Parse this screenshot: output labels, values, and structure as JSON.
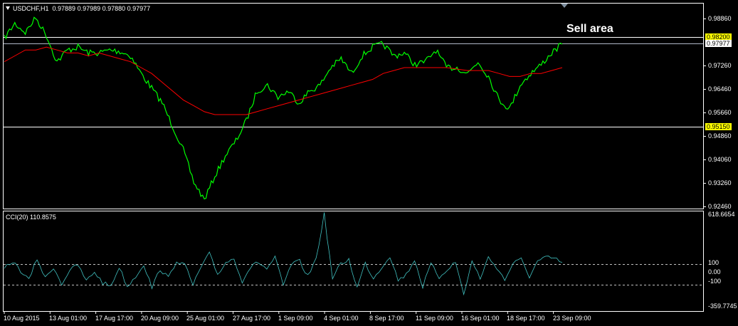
{
  "main_header": {
    "menu_icon": "triangle-down-icon",
    "symbol": "USDCHF,H1",
    "ohlc": "0.97889 0.97989 0.97880 0.97977"
  },
  "indicator_header": "CCI(20) 110.8575",
  "annotation": "Sell area",
  "levels": {
    "resistance": "0.98200",
    "current": "0.97977",
    "support": "0.95150"
  },
  "colors": {
    "background": "#000000",
    "price_line": "#00ff00",
    "moving_average": "#ff0000",
    "cci_line": "#40c0c0",
    "level_tag": "#ffff00",
    "current_tag": "#ffffff"
  },
  "chart_data": [
    {
      "type": "line",
      "symbol": "USDCHF",
      "timeframe": "H1",
      "title": "USDCHF,H1",
      "ylim": [
        0.9246,
        0.9886
      ],
      "y_ticks": [
        "0.98860",
        "0.97977",
        "0.97260",
        "0.96460",
        "0.95660",
        "0.94860",
        "0.94060",
        "0.93260",
        "0.92460"
      ],
      "x_ticks": [
        "10 Aug 2015",
        "13 Aug 01:00",
        "17 Aug 17:00",
        "20 Aug 09:00",
        "25 Aug 01:00",
        "27 Aug 17:00",
        "1 Sep 09:00",
        "4 Sep 01:00",
        "8 Sep 17:00",
        "11 Sep 09:00",
        "16 Sep 01:00",
        "18 Sep 17:00",
        "23 Sep 09:00"
      ],
      "series": [
        {
          "values": [
            0.982,
            0.987,
            0.984,
            0.989,
            0.983,
            0.974,
            0.978,
            0.979,
            0.977,
            0.977,
            0.978,
            0.9775,
            0.976,
            0.97,
            0.965,
            0.96,
            0.952,
            0.944,
            0.933,
            0.927,
            0.935,
            0.942,
            0.947,
            0.954,
            0.964,
            0.966,
            0.962,
            0.964,
            0.96,
            0.964,
            0.966,
            0.972,
            0.975,
            0.97,
            0.976,
            0.979,
            0.98,
            0.976,
            0.977,
            0.973,
            0.974,
            0.978,
            0.972,
            0.972,
            0.97,
            0.974,
            0.969,
            0.961,
            0.958,
            0.966,
            0.97,
            0.973,
            0.977,
            0.98
          ]
        },
        {
          "values": [
            0.974,
            0.976,
            0.978,
            0.978,
            0.979,
            0.978,
            0.977,
            0.977,
            0.976,
            0.977,
            0.976,
            0.975,
            0.974,
            0.972,
            0.97,
            0.967,
            0.964,
            0.961,
            0.959,
            0.957,
            0.956,
            0.956,
            0.956,
            0.956,
            0.957,
            0.958,
            0.959,
            0.96,
            0.961,
            0.962,
            0.963,
            0.964,
            0.965,
            0.966,
            0.967,
            0.968,
            0.97,
            0.971,
            0.972,
            0.972,
            0.972,
            0.972,
            0.972,
            0.9715,
            0.971,
            0.971,
            0.971,
            0.97,
            0.969,
            0.969,
            0.97,
            0.97,
            0.971,
            0.972
          ]
        }
      ],
      "horizontal_lines": [
        0.982,
        0.97977,
        0.9515
      ]
    },
    {
      "type": "line",
      "title": "CCI(20) 110.8575",
      "ylim": [
        -359.7745,
        618.6654
      ],
      "y_ticks": [
        "618.6654",
        "100",
        "0.00",
        "-100",
        "-359.7745"
      ],
      "reference_levels": [
        100,
        -100
      ],
      "series": [
        {
          "values": [
            40,
            120,
            20,
            -80,
            150,
            -60,
            60,
            -120,
            30,
            80,
            -90,
            10,
            -110,
            -140,
            60,
            -150,
            -40,
            90,
            -160,
            40,
            -60,
            130,
            80,
            -130,
            60,
            200,
            -20,
            110,
            150,
            -90,
            60,
            110,
            40,
            160,
            -140,
            90,
            120,
            -40,
            150,
            620,
            -60,
            90,
            140,
            -160,
            100,
            -60,
            60,
            180,
            -80,
            -20,
            140,
            -150,
            90,
            -50,
            40,
            110,
            -230,
            120,
            -60,
            160,
            60,
            -80,
            100,
            140,
            -40,
            120,
            160,
            150,
            110
          ]
        }
      ]
    }
  ]
}
